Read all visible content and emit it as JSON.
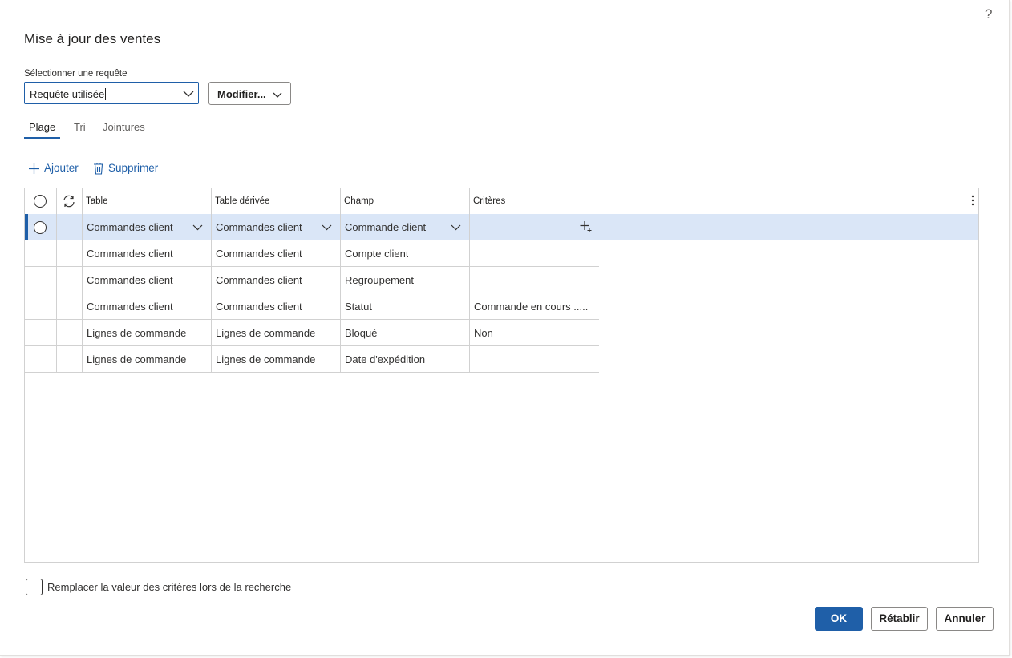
{
  "dialog": {
    "title": "Mise à jour des ventes",
    "help_glyph": "?"
  },
  "query": {
    "label": "Sélectionner une requête",
    "value": "Requête utilisée",
    "modify_label": "Modifier..."
  },
  "tabs": [
    {
      "label": "Plage",
      "active": true
    },
    {
      "label": "Tri",
      "active": false
    },
    {
      "label": "Jointures",
      "active": false
    }
  ],
  "actions": {
    "add_label": "Ajouter",
    "delete_label": "Supprimer"
  },
  "grid": {
    "columns": [
      "Table",
      "Table dérivée",
      "Champ",
      "Critères"
    ],
    "rows": [
      {
        "table": "Commandes client",
        "derived": "Commandes client",
        "field": "Commande client",
        "criteria": "",
        "selected": true
      },
      {
        "table": "Commandes client",
        "derived": "Commandes client",
        "field": "Compte client",
        "criteria": ""
      },
      {
        "table": "Commandes client",
        "derived": "Commandes client",
        "field": "Regroupement",
        "criteria": ""
      },
      {
        "table": "Commandes client",
        "derived": "Commandes client",
        "field": "Statut",
        "criteria": "Commande en cours ....."
      },
      {
        "table": "Lignes de commande",
        "derived": "Lignes de commande",
        "field": "Bloqué",
        "criteria": "Non"
      },
      {
        "table": "Lignes de commande",
        "derived": "Lignes de commande",
        "field": "Date d'expédition",
        "criteria": ""
      }
    ]
  },
  "options": {
    "replace_criteria_label": "Remplacer la valeur des critères lors de la recherche",
    "replace_criteria_checked": false
  },
  "buttons": {
    "ok": "OK",
    "reset": "Rétablir",
    "cancel": "Annuler"
  },
  "colors": {
    "accent": "#1f5fa8",
    "selected_row": "#dae6f7"
  }
}
